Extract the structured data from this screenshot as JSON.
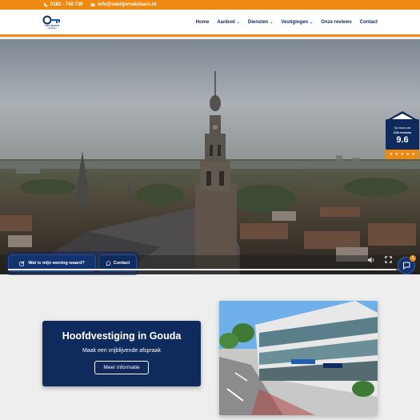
{
  "topbar": {
    "phone": "0182 - 748 739",
    "email": "info@vanrijnmakelaars.nl",
    "phone_icon": "phone-icon",
    "email_icon": "mail-icon",
    "bg_color": "#ee8a12"
  },
  "header": {
    "logo_text": "VAN RIJEN",
    "logo_sub": "makelaars",
    "nav": [
      {
        "label": "Home"
      },
      {
        "label": "Aanbod"
      },
      {
        "label": "Diensten"
      },
      {
        "label": "Vestigingen"
      },
      {
        "label": "Onze reviews"
      },
      {
        "label": "Contact"
      }
    ]
  },
  "hero": {
    "badge": {
      "line1": "Op basis van",
      "line2": "218 reviews",
      "score": "9.6",
      "stars": "★ ★ ★ ★ ★"
    },
    "cta_value_label": "Wat is mijn woning waard?",
    "cta_contact_label": "Contact",
    "video_progress": 0.97,
    "chat_count": "1"
  },
  "section": {
    "title": "Hoofdvestiging in Gouda",
    "subtitle": "Maak een vrijblijvende afspraak",
    "button": "Meer informatie"
  },
  "colors": {
    "accent": "#ee8a12",
    "brand_navy": "#0f2a5c"
  }
}
